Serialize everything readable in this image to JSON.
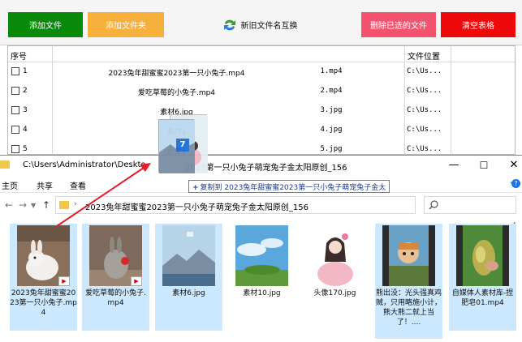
{
  "toolbar": {
    "add_file": "添加文件",
    "add_folder": "添加文件夹",
    "swap_names": "新旧文件名互换",
    "delete_selected": "删除已选的文件",
    "clear_table": "清空表格",
    "colors": {
      "green": "#0a8a0a",
      "orange": "#f7b03c",
      "pink": "#f3536f",
      "red": "#ee0a0a"
    }
  },
  "table": {
    "col_seq": "序号",
    "col_location": "文件位置",
    "rows": [
      {
        "num": "1",
        "name": "2023兔年甜蜜蜜2023第一只小兔子.mp4",
        "new": "1.mp4",
        "loc": "C:\\Us..."
      },
      {
        "num": "2",
        "name": "爱吃草莓的小兔子.mp4",
        "new": "2.mp4",
        "loc": "C:\\Us..."
      },
      {
        "num": "3",
        "name": "素材6.jpg",
        "new": "3.jpg",
        "loc": "C:\\Us..."
      },
      {
        "num": "4",
        "name": "素材1",
        "new": "4.jpg",
        "loc": "C:\\Us..."
      },
      {
        "num": "5",
        "name": "头像1",
        "new": "5.jpg",
        "loc": "C:\\Us..."
      }
    ]
  },
  "explorer": {
    "title_path": "C:\\Users\\Administrator\\Deskto",
    "title_suffix": "2023第一只小兔子萌宠兔子金太阳原创_156",
    "ribbon": {
      "home": "主页",
      "share": "共享",
      "view": "查看",
      "help": "?"
    },
    "address": "2023兔年甜蜜蜜2023第一只小兔子萌宠兔子金太阳原创_156",
    "files": [
      {
        "label": "2023兔年甜蜜蜜2023第一只小兔子.mp4",
        "icon": "rabbit-video-thumb",
        "selected": true
      },
      {
        "label": "爱吃草莓的小兔子.mp4",
        "icon": "rabbit-strawberry-thumb",
        "selected": true
      },
      {
        "label": "素材6.jpg",
        "icon": "landscape-thumb",
        "selected": true
      },
      {
        "label": "素材10.jpg",
        "icon": "sky-thumb",
        "selected": false
      },
      {
        "label": "头像170.jpg",
        "icon": "girl-portrait-thumb",
        "selected": false
      },
      {
        "label": "熊出没：光头强真鸡贼，只用略施小计，熊大熊二就上当了！....",
        "icon": "cartoon-video-thumb",
        "selected": true
      },
      {
        "label": "自媒体人素材库-捏肥皂01.mp4",
        "icon": "soap-video-thumb",
        "selected": true
      }
    ]
  },
  "drag": {
    "count": "7",
    "tip": "复制到 2023兔年甜蜜蜜2023第一只小兔子萌宠兔子金太",
    "tip_plus": "+"
  }
}
